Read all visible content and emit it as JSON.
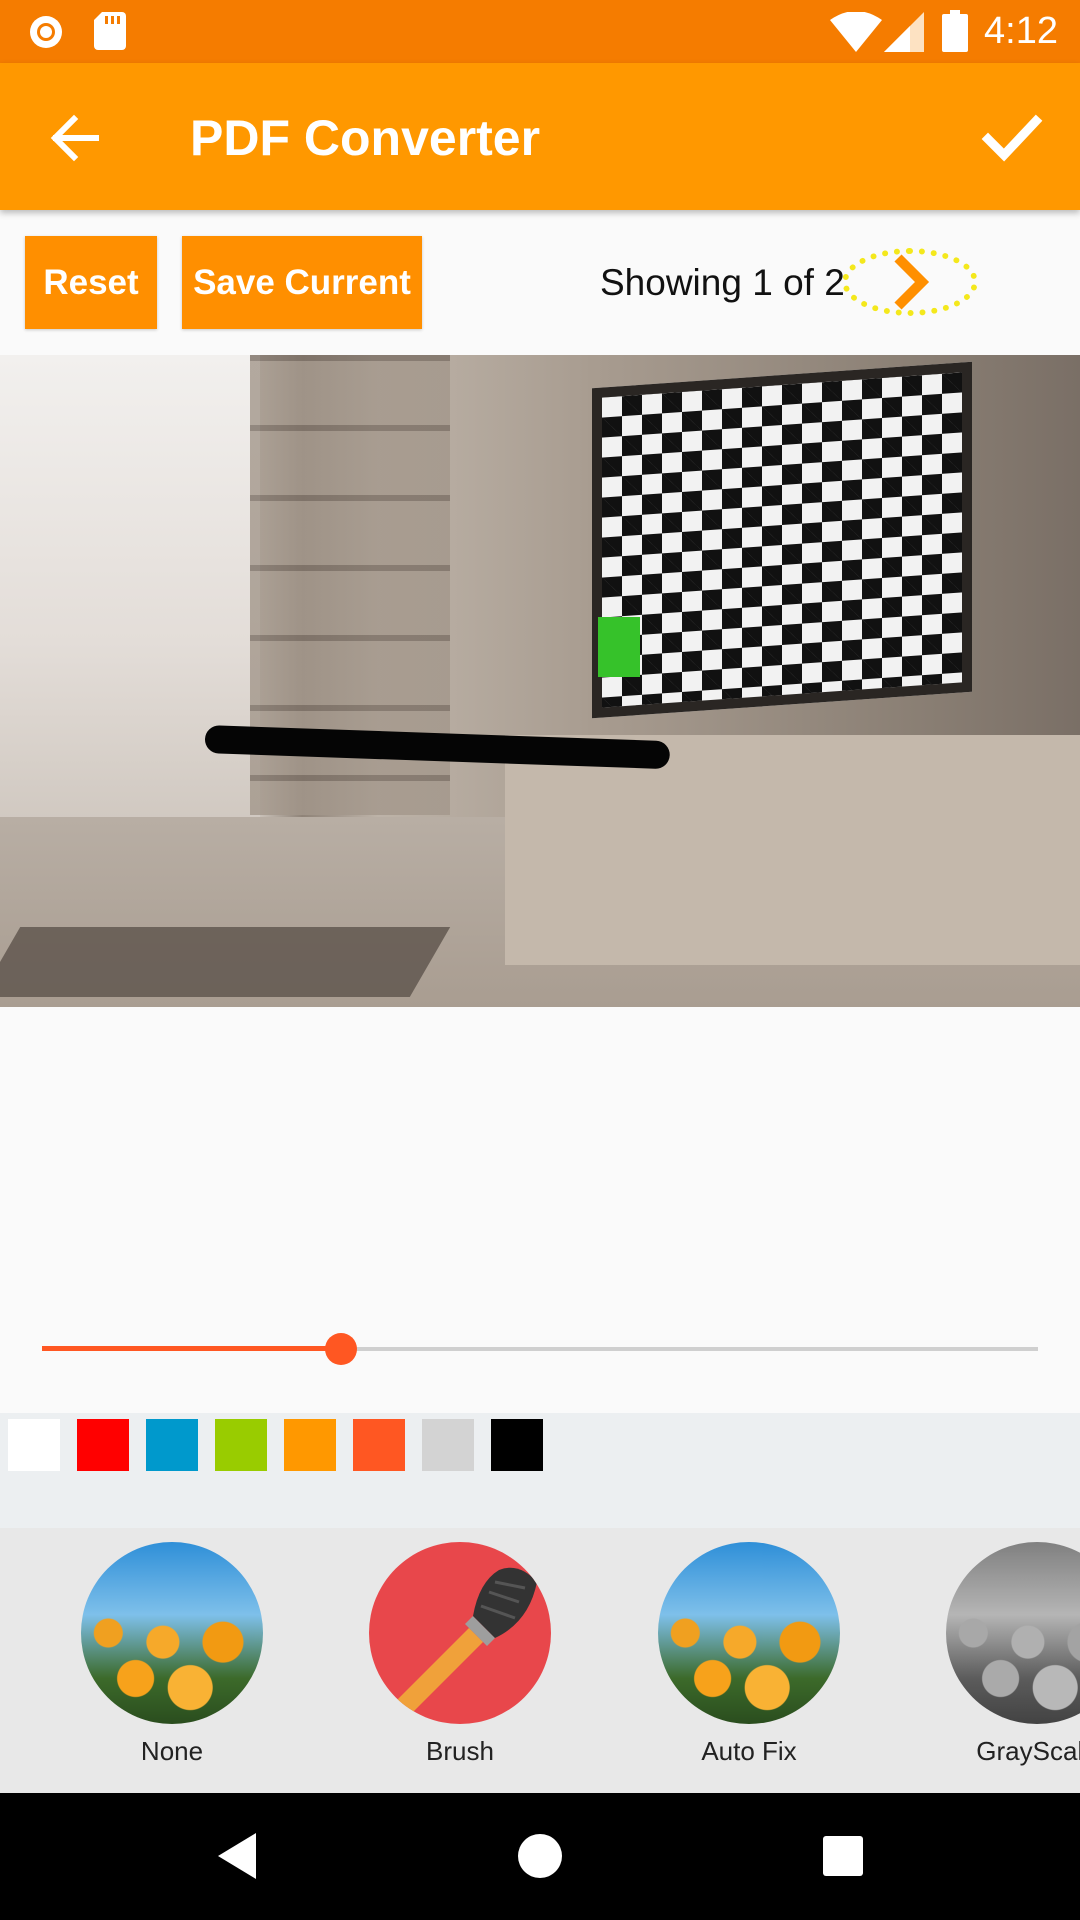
{
  "status_bar": {
    "time": "4:12",
    "icons": [
      "record-icon",
      "sd-card-icon",
      "wifi-icon",
      "signal-icon",
      "battery-icon"
    ]
  },
  "app_bar": {
    "title": "PDF Converter",
    "back_icon": "arrow-back-icon",
    "confirm_icon": "check-icon"
  },
  "toolbar": {
    "reset_label": "Reset",
    "save_label": "Save Current",
    "page_indicator": "Showing 1 of 2",
    "next_icon": "chevron-right-icon"
  },
  "brush": {
    "size_fraction": 0.3
  },
  "colors": {
    "primary_dark": "#f57c00",
    "primary": "#ff9800",
    "accent": "#ff5722",
    "palette": [
      "#ffffff",
      "#ff0000",
      "#0099cc",
      "#99cc00",
      "#ff9800",
      "#ff5722",
      "#d3d3d3",
      "#000000"
    ]
  },
  "filters": [
    {
      "label": "None",
      "icon": "flower-thumbnail"
    },
    {
      "label": "Brush",
      "icon": "brush-icon"
    },
    {
      "label": "Auto Fix",
      "icon": "flower-thumbnail"
    },
    {
      "label": "GrayScale",
      "icon": "flower-grayscale-thumbnail"
    }
  ],
  "nav_bar": {
    "icons": [
      "back-triangle-icon",
      "home-circle-icon",
      "recents-square-icon"
    ]
  }
}
